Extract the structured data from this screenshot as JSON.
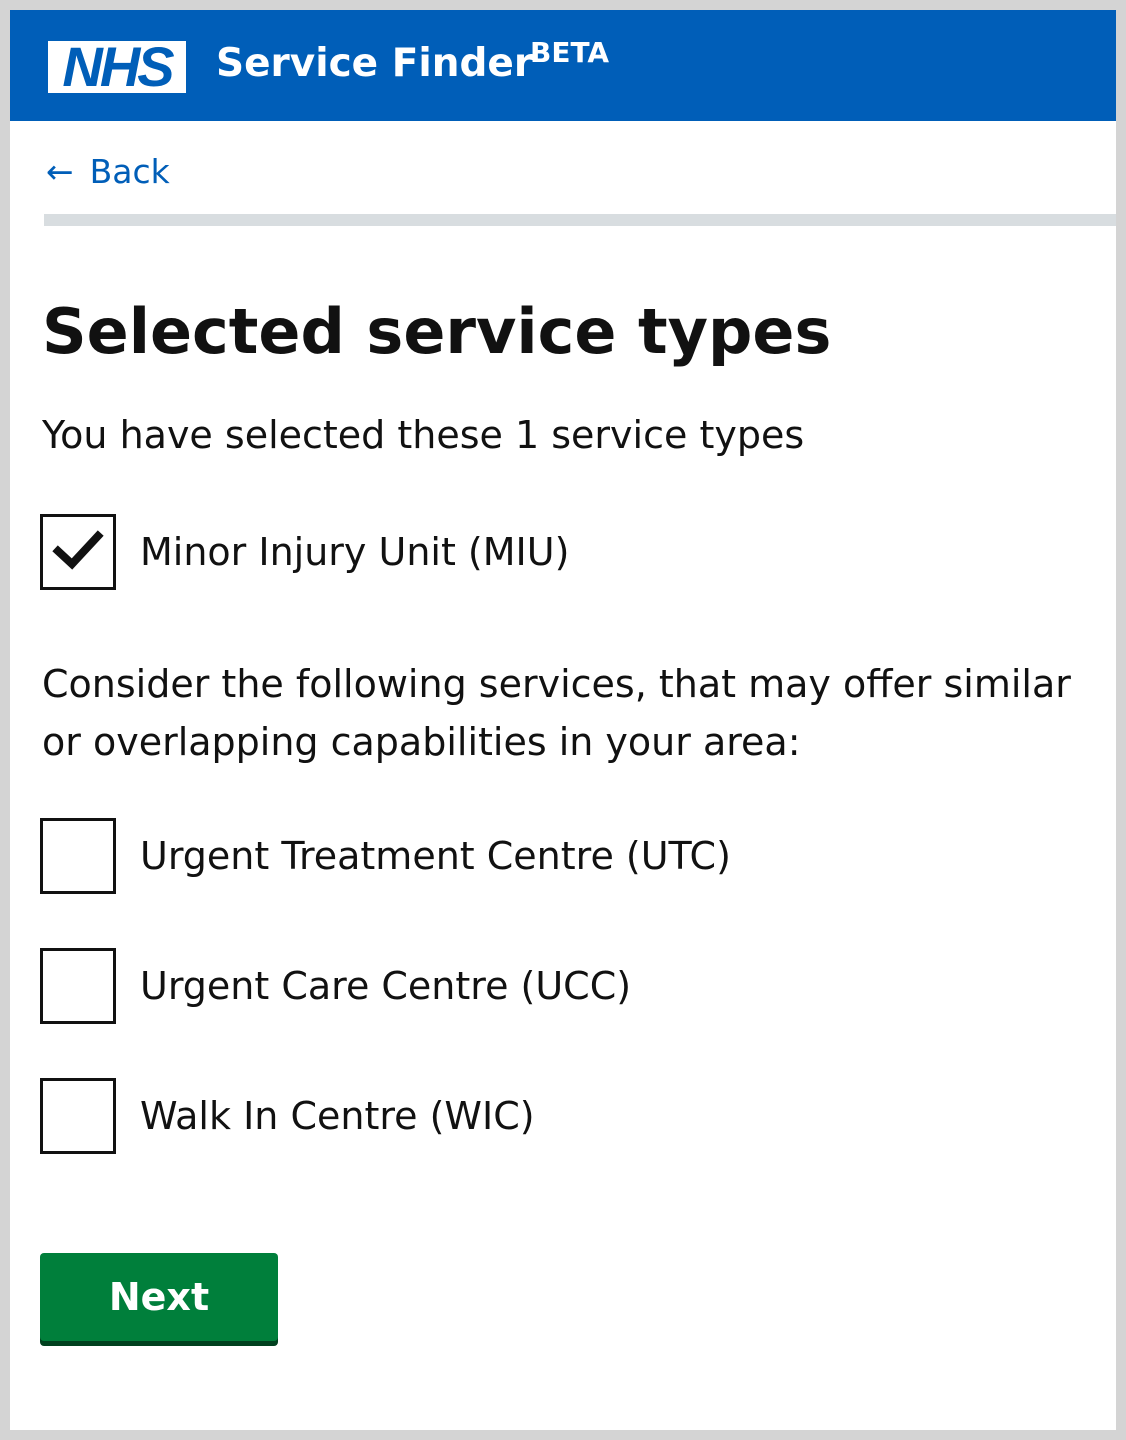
{
  "header": {
    "logo_text": "NHS",
    "service_name": "Service Finder",
    "beta_label": "BETA",
    "brand_color": "#005eb8"
  },
  "navigation": {
    "back_arrow": "←",
    "back_label": "Back"
  },
  "main": {
    "title": "Selected service types",
    "selected_summary": "You have selected these 1 service types",
    "selected_services": [
      {
        "label": "Minor Injury Unit (MIU)",
        "checked": true
      }
    ],
    "consider_text": "Consider the following services, that may offer similar or  overlapping capabilities in your area:",
    "suggested_services": [
      {
        "label": "Urgent Treatment Centre (UTC)",
        "checked": false
      },
      {
        "label": "Urgent Care Centre (UCC)",
        "checked": false
      },
      {
        "label": "Walk In Centre (WIC)",
        "checked": false
      }
    ],
    "next_label": "Next",
    "button_color": "#007f3b"
  }
}
